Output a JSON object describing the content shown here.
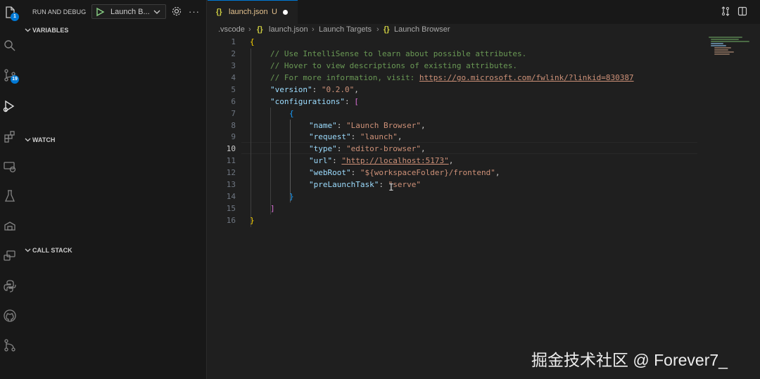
{
  "activity_bar": {
    "items": [
      {
        "name": "explorer-icon",
        "badge": "1"
      },
      {
        "name": "search-icon",
        "badge": ""
      },
      {
        "name": "source-control-icon",
        "badge": "19"
      },
      {
        "name": "run-debug-icon",
        "badge": ""
      },
      {
        "name": "extensions-icon",
        "badge": ""
      },
      {
        "name": "remote-explorer-icon",
        "badge": ""
      },
      {
        "name": "testing-icon",
        "badge": ""
      },
      {
        "name": "containers-icon",
        "badge": ""
      },
      {
        "name": "remote-desktop-icon",
        "badge": ""
      },
      {
        "name": "python-icon",
        "badge": ""
      },
      {
        "name": "github-icon",
        "badge": ""
      },
      {
        "name": "git-graph-icon",
        "badge": ""
      }
    ]
  },
  "sidebar": {
    "title": "RUN AND DEBUG",
    "launch_config": "Launch B...",
    "more": "···",
    "sections": {
      "variables": "VARIABLES",
      "watch": "WATCH",
      "call_stack": "CALL STACK"
    }
  },
  "editor": {
    "tab": {
      "icon": "{}",
      "label": "launch.json",
      "status": "U"
    },
    "breadcrumb": [
      ".vscode",
      "launch.json",
      "Launch Targets",
      "Launch Browser"
    ],
    "breadcrumb_icon": "{}",
    "line_numbers": [
      "1",
      "2",
      "3",
      "4",
      "5",
      "6",
      "7",
      "8",
      "9",
      "10",
      "11",
      "12",
      "13",
      "14",
      "15",
      "16"
    ],
    "active_line": "10",
    "code": {
      "l1": "{",
      "l2": "// Use IntelliSense to learn about possible attributes.",
      "l3": "// Hover to view descriptions of existing attributes.",
      "l4_text": "// For more information, visit: ",
      "l4_link": "https://go.microsoft.com/fwlink/?linkid=830387",
      "l5_key": "\"version\"",
      "l5_val": "\"0.2.0\"",
      "l6_key": "\"configurations\"",
      "l6_open": "[",
      "l7": "{",
      "l8_key": "\"name\"",
      "l8_val": "\"Launch Browser\"",
      "l9_key": "\"request\"",
      "l9_val": "\"launch\"",
      "l10_key": "\"type\"",
      "l10_val": "\"editor-browser\"",
      "l11_key": "\"url\"",
      "l11_val": "\"http://localhost:5173\"",
      "l12_key": "\"webRoot\"",
      "l12_val": "\"${workspaceFolder}/frontend\"",
      "l13_key": "\"preLaunchTask\"",
      "l13_val": "\"serve\"",
      "l14": "}",
      "l15": "]",
      "l16": "}"
    }
  },
  "watermark": "掘金技术社区 @ Forever7_",
  "colors": {
    "accent": "#0078d4",
    "modified": "#e2c08d",
    "comment": "#6a9955",
    "key": "#9cdcfe",
    "string": "#ce9178"
  }
}
